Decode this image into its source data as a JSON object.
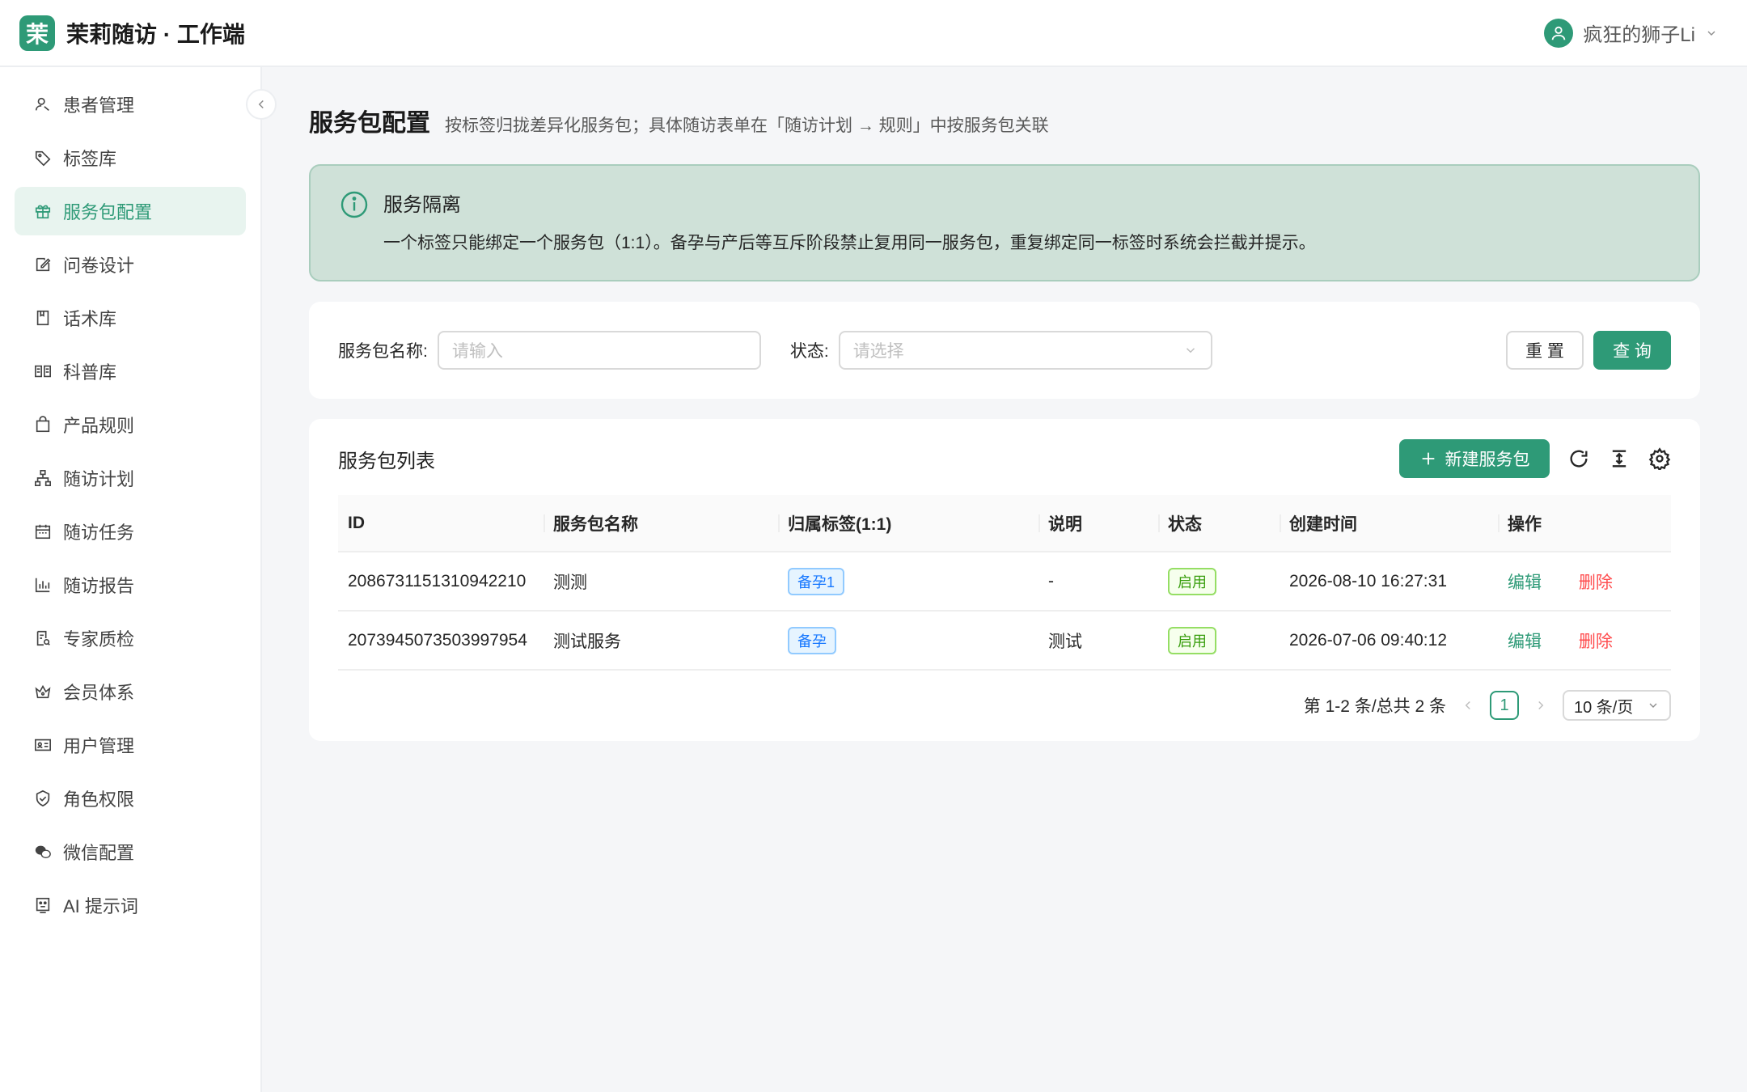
{
  "header": {
    "logo_char": "茉",
    "app_title": "茉莉随访 · 工作端",
    "user_name": "疯狂的狮子Li"
  },
  "sidebar": {
    "items": [
      {
        "label": "患者管理",
        "icon": "users-icon"
      },
      {
        "label": "标签库",
        "icon": "tag-icon"
      },
      {
        "label": "服务包配置",
        "icon": "gift-icon",
        "active": true
      },
      {
        "label": "问卷设计",
        "icon": "edit-icon"
      },
      {
        "label": "话术库",
        "icon": "book-icon"
      },
      {
        "label": "科普库",
        "icon": "read-icon"
      },
      {
        "label": "产品规则",
        "icon": "shopping-bag-icon"
      },
      {
        "label": "随访计划",
        "icon": "cluster-icon"
      },
      {
        "label": "随访任务",
        "icon": "calendar-icon"
      },
      {
        "label": "随访报告",
        "icon": "bar-chart-icon"
      },
      {
        "label": "专家质检",
        "icon": "audit-icon"
      },
      {
        "label": "会员体系",
        "icon": "crown-icon"
      },
      {
        "label": "用户管理",
        "icon": "id-card-icon"
      },
      {
        "label": "角色权限",
        "icon": "shield-icon"
      },
      {
        "label": "微信配置",
        "icon": "wechat-icon"
      },
      {
        "label": "AI 提示词",
        "icon": "robot-icon"
      }
    ]
  },
  "page": {
    "title": "服务包配置",
    "subtitle": "按标签归拢差异化服务包；具体随访表单在「随访计划 → 规则」中按服务包关联"
  },
  "alert": {
    "title": "服务隔离",
    "description": "一个标签只能绑定一个服务包（1:1）。备孕与产后等互斥阶段禁止复用同一服务包，重复绑定同一标签时系统会拦截并提示。"
  },
  "filter": {
    "name_label": "服务包名称:",
    "name_placeholder": "请输入",
    "status_label": "状态:",
    "status_placeholder": "请选择",
    "reset_label": "重 置",
    "query_label": "查 询"
  },
  "list": {
    "title": "服务包列表",
    "new_button": "新建服务包",
    "columns": [
      "ID",
      "服务包名称",
      "归属标签(1:1)",
      "说明",
      "状态",
      "创建时间",
      "操作"
    ],
    "rows": [
      {
        "id": "2086731151310942210",
        "name": "测测",
        "tag": "备孕1",
        "desc": "-",
        "status": "启用",
        "created": "2026-08-10 16:27:31",
        "edit": "编辑",
        "delete": "删除"
      },
      {
        "id": "2073945073503997954",
        "name": "测试服务",
        "tag": "备孕",
        "desc": "测试",
        "status": "启用",
        "created": "2026-07-06 09:40:12",
        "edit": "编辑",
        "delete": "删除"
      }
    ]
  },
  "pagination": {
    "total_text": "第 1-2 条/总共 2 条",
    "current_page": "1",
    "page_size": "10 条/页"
  },
  "colors": {
    "primary": "#2e9a77",
    "danger": "#ff4d4f",
    "alert_bg": "#cfe1d8"
  }
}
